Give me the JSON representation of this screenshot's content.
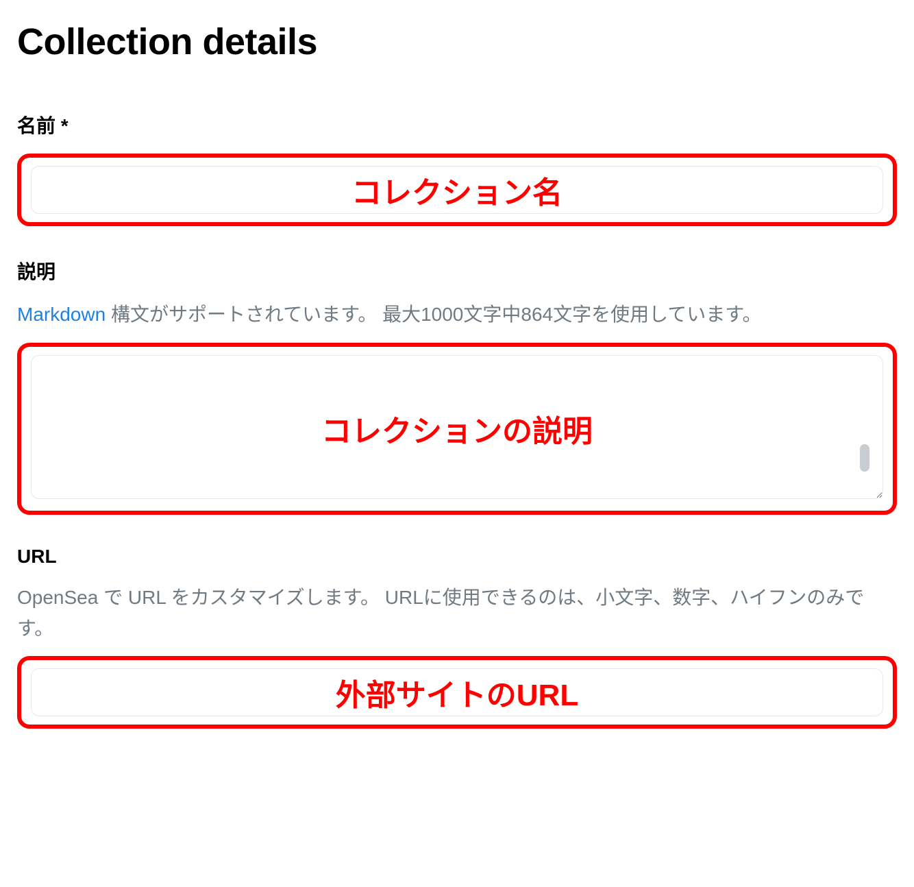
{
  "header": {
    "title": "Collection details"
  },
  "fields": {
    "name": {
      "label": "名前",
      "required_mark": "*",
      "value": ""
    },
    "description": {
      "label": "説明",
      "help_link_text": "Markdown",
      "help_text_rest": " 構文がサポートされています。 最大1000文字中864文字を使用しています。",
      "value": ""
    },
    "url": {
      "label": "URL",
      "help_text": "OpenSea で URL をカスタマイズします。 URLに使用できるのは、小文字、数字、ハイフンのみです。",
      "value": ""
    }
  },
  "annotations": {
    "name_overlay": "コレクション名",
    "description_overlay": "コレクションの説明",
    "url_overlay": "外部サイトのURL",
    "highlight_color": "#ff0000"
  }
}
